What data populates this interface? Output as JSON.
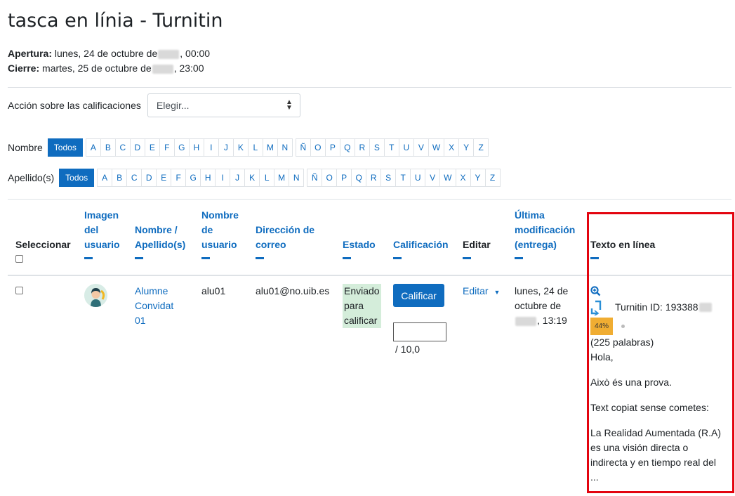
{
  "page": {
    "title": "tasca en línia - Turnitin",
    "opening_label": "Apertura:",
    "opening_value_a": "lunes, 24 de octubre de",
    "opening_value_b": ", 00:00",
    "closing_label": "Cierre:",
    "closing_value_a": "martes, 25 de octubre de",
    "closing_value_b": ", 23:00"
  },
  "actions": {
    "label": "Acción sobre las calificaciones",
    "select_value": "Elegir..."
  },
  "filters": {
    "first_name_label": "Nombre",
    "last_name_label": "Apellido(s)",
    "all_label": "Todos",
    "letters": [
      "A",
      "B",
      "C",
      "D",
      "E",
      "F",
      "G",
      "H",
      "I",
      "J",
      "K",
      "L",
      "M",
      "N",
      "Ñ",
      "O",
      "P",
      "Q",
      "R",
      "S",
      "T",
      "U",
      "V",
      "W",
      "X",
      "Y",
      "Z"
    ]
  },
  "table": {
    "headers": {
      "select": "Seleccionar",
      "image": [
        "Imagen",
        "del",
        "usuario"
      ],
      "name": [
        "Nombre /",
        "Apellido(s)"
      ],
      "username": [
        "Nombre",
        "de",
        "usuario"
      ],
      "email": [
        "Dirección de",
        "correo"
      ],
      "status": "Estado",
      "grade": "Calificación",
      "edit": "Editar",
      "modified": [
        "Última",
        "modificación",
        "(entrega)"
      ],
      "online_text": "Texto en línea"
    },
    "row": {
      "name": [
        "Alumne",
        "Convidat",
        "01"
      ],
      "username": "alu01",
      "email": "alu01@no.uib.es",
      "status": [
        "Enviado",
        "para",
        "calificar"
      ],
      "grade_button": "Calificar",
      "grade_max": "/ 10,0",
      "edit_label": "Editar",
      "modified": [
        "lunes, 24 de",
        "octubre de",
        ", 13:19"
      ],
      "turnitin_id": "Turnitin ID: 193388",
      "similarity": "44%",
      "word_count": "(225 palabras)",
      "text_lines": [
        "Hola,",
        "Això és una prova.",
        "Text copiat sense cometes:",
        "La Realidad Aumentada (R.A)",
        "es una visión directa o",
        "indirecta y en tiempo real del",
        "..."
      ]
    }
  },
  "colors": {
    "accent": "#0f6cbf",
    "highlight_box": "#e3040f",
    "status_bg": "#d4edda",
    "badge": "#f0ad32"
  }
}
